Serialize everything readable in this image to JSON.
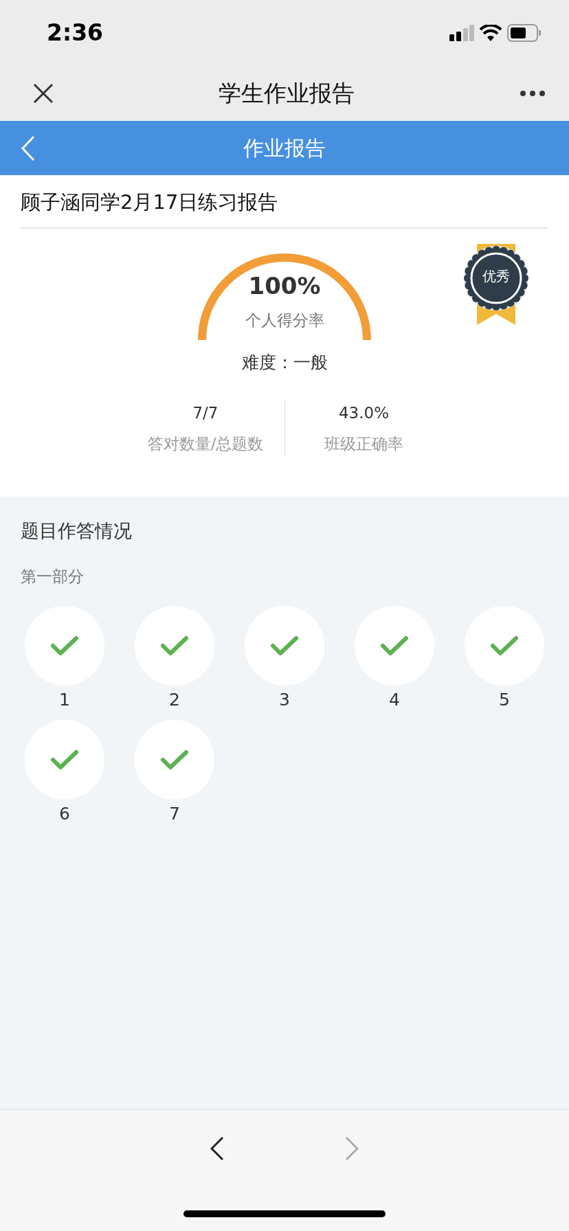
{
  "status_bar": {
    "time": "2:36"
  },
  "nav_bar": {
    "title": "学生作业报告"
  },
  "header": {
    "title": "作业报告"
  },
  "report": {
    "title": "顾子涵同学2月17日练习报告",
    "badge": "优秀",
    "score": {
      "value": "100%",
      "label": "个人得分率",
      "level": 1.0
    },
    "difficulty": "难度：一般",
    "stats": [
      {
        "value": "7/7",
        "label": "答对数量/总题数"
      },
      {
        "value": "43.0%",
        "label": "班级正确率"
      }
    ]
  },
  "answers": {
    "title": "题目作答情况",
    "parts": [
      {
        "title": "第一部分",
        "questions": [
          {
            "number": "1",
            "correct": true
          },
          {
            "number": "2",
            "correct": true
          },
          {
            "number": "3",
            "correct": true
          },
          {
            "number": "4",
            "correct": true
          },
          {
            "number": "5",
            "correct": true
          },
          {
            "number": "6",
            "correct": true
          },
          {
            "number": "7",
            "correct": true
          }
        ]
      }
    ]
  },
  "bottom_nav": {
    "back_disabled": false,
    "forward_disabled": true
  }
}
